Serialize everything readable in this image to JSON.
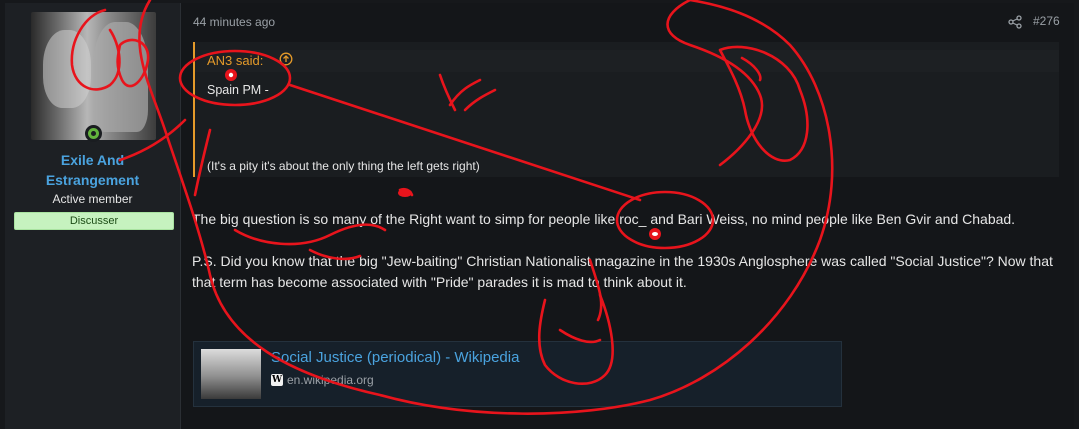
{
  "user": {
    "name_line1": "Exile And",
    "name_line2": "Estrangement",
    "title": "Active member",
    "banner": "Discusser"
  },
  "post": {
    "time": "44 minutes ago",
    "number": "#276",
    "quote": {
      "author": "AN3 said:",
      "line1": "Spain PM -",
      "line2": "(It's a pity it's about the only thing the left gets right)"
    },
    "paragraphs": [
      "The big question is so many of the Right want to simp for people like roc_ and Bari Weiss, no mind people like Ben Gvir and Chabad.",
      "P.S. Did you know that the big \"Jew-baiting\" Christian Nationalist magazine in the 1930s Anglosphere was called \"Social Justice\"? Now that that term has become associated with \"Pride\" parades it is mad to think about it."
    ],
    "link_card": {
      "title": "Social Justice (periodical) - Wikipedia",
      "domain": "en.wikipedia.org",
      "favicon": "W"
    }
  },
  "colors": {
    "accent": "#4aa3df",
    "quote_accent": "#e49a2a",
    "banner_bg": "#c6f2bf",
    "online": "#63b33d",
    "scribble": "#e8141c"
  },
  "icons": [
    "share-icon",
    "arrow-up-circle-icon",
    "wikipedia-icon",
    "online-status-icon"
  ]
}
